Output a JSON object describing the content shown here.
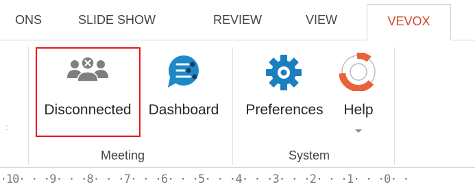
{
  "tabs": [
    {
      "label": "ONS"
    },
    {
      "label": "SLIDE SHOW"
    },
    {
      "label": "REVIEW"
    },
    {
      "label": "VIEW"
    },
    {
      "label": "VEVOX",
      "active": true
    }
  ],
  "groups": {
    "meeting": {
      "label": "Meeting",
      "buttons": {
        "disconnected": {
          "label": "Disconnected",
          "icon": "users-disconnected-icon"
        },
        "dashboard": {
          "label": "Dashboard",
          "icon": "dashboard-chat-icon"
        }
      }
    },
    "system": {
      "label": "System",
      "buttons": {
        "preferences": {
          "label": "Preferences",
          "icon": "gear-icon"
        },
        "help": {
          "label": "Help",
          "icon": "lifebuoy-icon"
        }
      }
    }
  },
  "ruler": {
    "text": "·10· · ·9· · ·8· · ·7· · ·6· · ·5· · ·4· · ·3· · ·2· · ·1· · ·0· ·"
  },
  "colors": {
    "active_tab_text": "#d24726",
    "highlight_border": "#e8141a",
    "dashboard_blue": "#1e88c8",
    "gear_blue": "#1a7fc1",
    "users_gray": "#7f7f7f"
  }
}
